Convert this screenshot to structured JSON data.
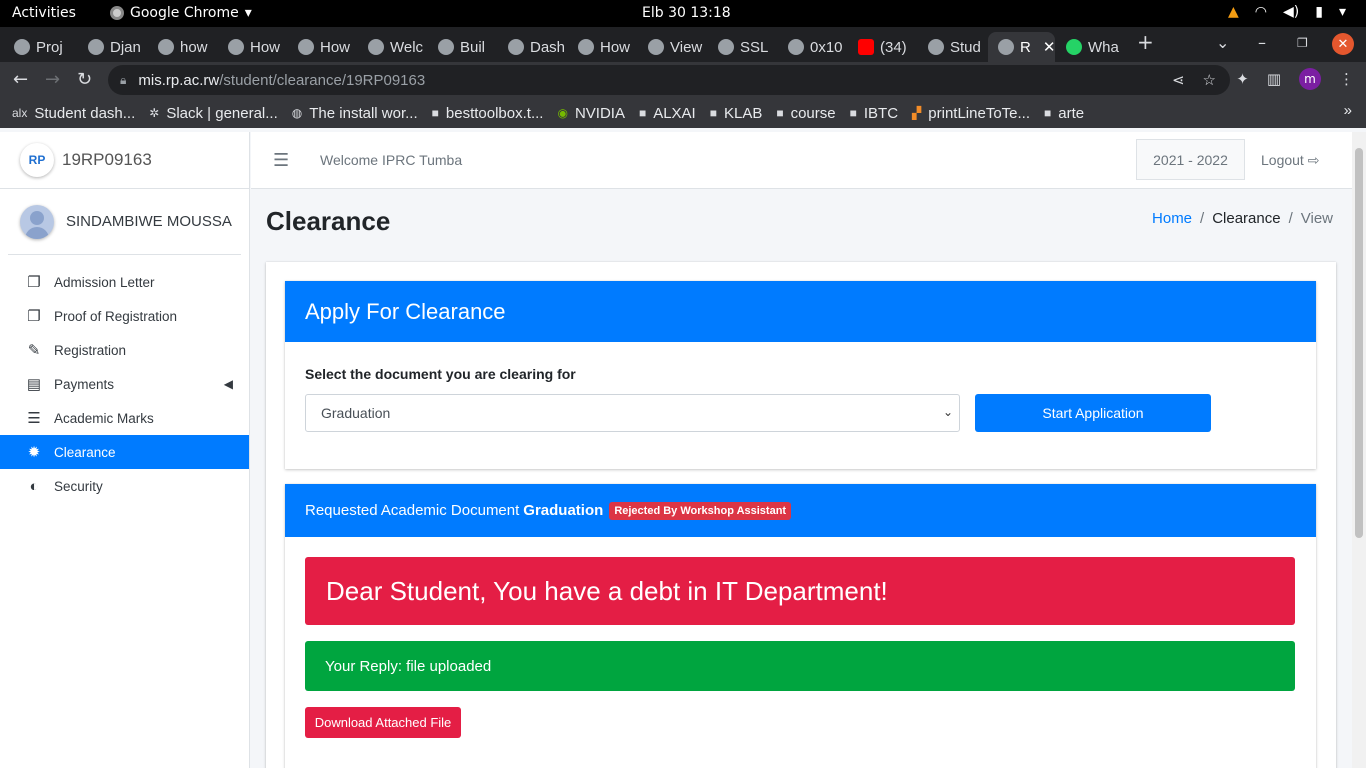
{
  "os": {
    "activities": "Activities",
    "app_name": "Google Chrome",
    "clock": "Elb 30  13:18"
  },
  "browser": {
    "tabs": [
      {
        "label": "Proj"
      },
      {
        "label": "Djan"
      },
      {
        "label": "how"
      },
      {
        "label": "How"
      },
      {
        "label": "How"
      },
      {
        "label": "Welc"
      },
      {
        "label": "Buil"
      },
      {
        "label": "Dash"
      },
      {
        "label": "How"
      },
      {
        "label": "View"
      },
      {
        "label": "SSL"
      },
      {
        "label": "0x10"
      },
      {
        "label": "(34)"
      },
      {
        "label": "Stud"
      },
      {
        "label": "R"
      },
      {
        "label": "Wha"
      }
    ],
    "url_host": "mis.rp.ac.rw",
    "url_path": "/student/clearance/19RP09163",
    "profile_initial": "m",
    "bookmarks": [
      {
        "label": "Student dash..."
      },
      {
        "label": "Slack | general..."
      },
      {
        "label": "The install wor..."
      },
      {
        "label": "besttoolbox.t..."
      },
      {
        "label": "NVIDIA"
      },
      {
        "label": "ALXAI"
      },
      {
        "label": "KLAB"
      },
      {
        "label": "course"
      },
      {
        "label": "IBTC"
      },
      {
        "label": "printLineToTe..."
      },
      {
        "label": "arte"
      }
    ]
  },
  "sidebar": {
    "brand_logo": "RP",
    "brand_text": "19RP09163",
    "user_name": "SINDAMBIWE MOUSSA",
    "items": [
      {
        "label": "Admission Letter",
        "icon": "copy-icon"
      },
      {
        "label": "Proof of Registration",
        "icon": "copy-icon"
      },
      {
        "label": "Registration",
        "icon": "edit-icon"
      },
      {
        "label": "Payments",
        "icon": "money-check-icon"
      },
      {
        "label": "Academic Marks",
        "icon": "tasks-icon"
      },
      {
        "label": "Clearance",
        "icon": "certificate-icon"
      },
      {
        "label": "Security",
        "icon": "shield-icon"
      }
    ]
  },
  "header": {
    "welcome": "Welcome IPRC Tumba",
    "year": "2021 - 2022",
    "logout": "Logout"
  },
  "content": {
    "title": "Clearance",
    "breadcrumb": {
      "home": "Home",
      "current": "Clearance",
      "last": "View"
    },
    "apply_card": {
      "title": "Apply For Clearance",
      "label": "Select the document you are clearing for",
      "selected": "Graduation",
      "button": "Start Application"
    },
    "request_card": {
      "prefix": "Requested Academic Document",
      "document": "Graduation",
      "status_badge": "Rejected By Workshop Assistant",
      "debt_message": "Dear Student, You have a debt in IT Department!",
      "reply": "Your Reply: file uploaded",
      "download_button": "Download Attached File"
    }
  },
  "colors": {
    "primary": "#007bff",
    "danger": "#e41e45",
    "success": "#00a53f"
  }
}
